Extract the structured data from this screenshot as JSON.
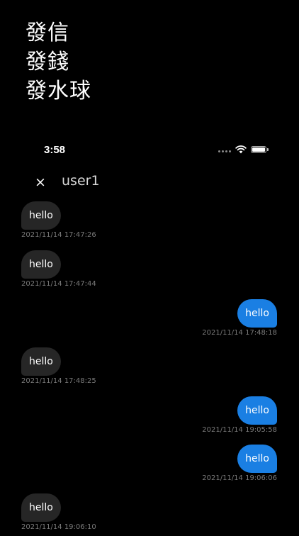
{
  "headline": {
    "lines": [
      "發信",
      "發錢",
      "發水球"
    ]
  },
  "status_bar": {
    "time": "3:58",
    "icons": [
      "cellular-signal-icon",
      "wifi-icon",
      "battery-icon"
    ]
  },
  "chat": {
    "close_icon": "×",
    "contact_name": "user1",
    "messages": [
      {
        "direction": "received",
        "text": "hello",
        "timestamp": "2021/11/14 17:47:26"
      },
      {
        "direction": "received",
        "text": "hello",
        "timestamp": "2021/11/14 17:47:44"
      },
      {
        "direction": "sent",
        "text": "hello",
        "timestamp": "2021/11/14 17:48:18"
      },
      {
        "direction": "received",
        "text": "hello",
        "timestamp": "2021/11/14 17:48:25"
      },
      {
        "direction": "sent",
        "text": "hello",
        "timestamp": "2021/11/14 19:05:58"
      },
      {
        "direction": "sent",
        "text": "hello",
        "timestamp": "2021/11/14 19:06:06"
      },
      {
        "direction": "received",
        "text": "hello",
        "timestamp": "2021/11/14 19:06:10"
      }
    ]
  },
  "colors": {
    "background": "#000000",
    "sent_bubble": "#1a7fe3",
    "received_bubble": "#262626",
    "timestamp_text": "#7a7a7a"
  }
}
